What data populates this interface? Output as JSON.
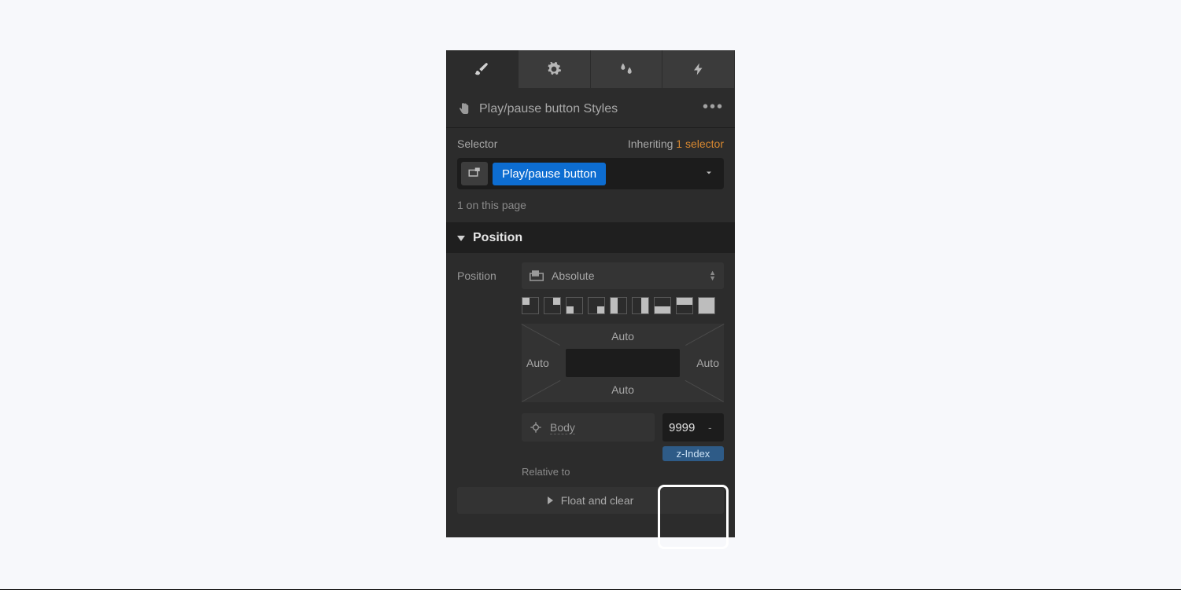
{
  "header": {
    "title": "Play/pause button Styles"
  },
  "selector": {
    "label": "Selector",
    "inheriting_prefix": "Inheriting ",
    "inheriting_count": "1 selector",
    "class_name": "Play/pause button",
    "page_count": "1 on this page"
  },
  "position": {
    "section_title": "Position",
    "label": "Position",
    "value": "Absolute",
    "offsets": {
      "top": "Auto",
      "right": "Auto",
      "bottom": "Auto",
      "left": "Auto"
    },
    "relative_to_label": "Relative to",
    "relative_to_value": "Body",
    "zindex_label": "z-Index",
    "zindex_value": "9999",
    "zindex_unit": "-",
    "float_label": "Float and clear"
  }
}
